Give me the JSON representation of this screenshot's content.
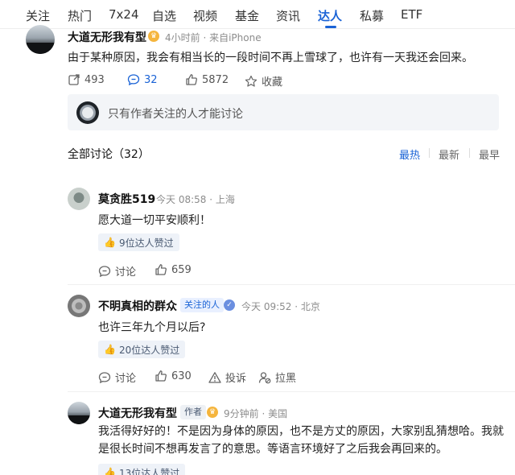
{
  "tabs": [
    "关注",
    "热门",
    "7x24",
    "自选",
    "视频",
    "基金",
    "资讯",
    "达人",
    "私募",
    "ETF"
  ],
  "post": {
    "author": "大道无形我有型",
    "meta": "4小时前 · 来自iPhone",
    "content": "由于某种原因，我会有相当长的一段时间不再上雪球了，也许有一天我还会回来。",
    "repost_count": "493",
    "comment_count": "32",
    "like_count": "5872",
    "collect_label": "收藏"
  },
  "restriction": {
    "text": "只有作者关注的人才能讨论"
  },
  "discussion": {
    "title": "全部讨论（32）",
    "sort_options": [
      "最热",
      "最新",
      "最早"
    ],
    "active_sort": "最热"
  },
  "comments": [
    {
      "author": "莫贪胜519",
      "meta": "今天 08:58 · 上海",
      "content": "愿大道一切平安顺利！",
      "badge": "9位达人赞过",
      "discuss_label": "讨论",
      "likes": "659"
    },
    {
      "author": "不明真相的群众",
      "tag": "关注的人",
      "meta": "今天 09:52 · 北京",
      "content": "也许三年九个月以后?",
      "badge": "20位达人赞过",
      "discuss_label": "讨论",
      "likes": "630",
      "report_label": "投诉",
      "block_label": "拉黑"
    },
    {
      "author": "大道无形我有型",
      "tag": "作者",
      "meta": "9分钟前 · 美国",
      "content": "我活得好好的！不是因为身体的原因，也不是方丈的原因，大家别乱猜想哈。我就是很长时间不想再发言了的意思。等语言环境好了之后我会再回来的。",
      "badge": "13位达人赞过"
    }
  ],
  "colors": {
    "accent": "#1a63d6",
    "badge_bg": "#eef2f8",
    "crown": "#f5b53d"
  }
}
